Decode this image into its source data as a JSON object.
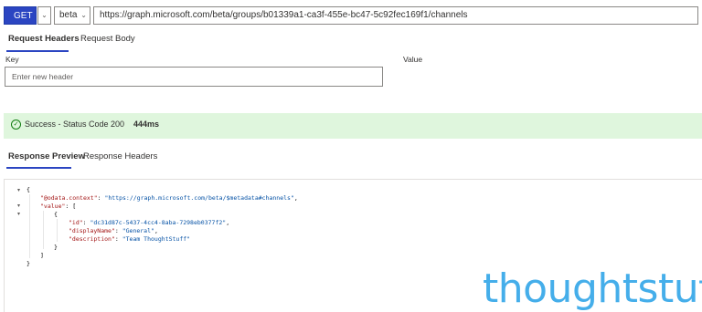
{
  "toolbar": {
    "method": "GET",
    "method_caret": "⌄",
    "version": "beta",
    "version_caret": "⌄",
    "url": "https://graph.microsoft.com/beta/groups/b01339a1-ca3f-455e-bc47-5c92fec169f1/channels"
  },
  "request_tabs": {
    "headers": "Request Headers",
    "body": "Request Body"
  },
  "headers_table": {
    "key_label": "Key",
    "value_label": "Value",
    "key_placeholder": "Enter new header"
  },
  "status": {
    "text": "Success - Status Code 200",
    "time": "444ms",
    "icon": "check-circle-icon"
  },
  "response_tabs": {
    "preview": "Response Preview",
    "headers": "Response Headers"
  },
  "response": {
    "open_brace": "{",
    "context_key": "\"@odata.context\"",
    "context_value": "\"https://graph.microsoft.com/beta/$metadata#channels\"",
    "value_key": "\"value\"",
    "open_bracket": "[",
    "item_open": "{",
    "id_key": "\"id\"",
    "id_value": "\"dc31d87c-5437-4cc4-8aba-7298eb0377f2\"",
    "name_key": "\"displayName\"",
    "name_value": "\"General\"",
    "desc_key": "\"description\"",
    "desc_value": "\"Team ThoughtStuff\"",
    "item_close": "}",
    "close_bracket": "]",
    "close_brace": "}"
  },
  "watermark": "thoughtstuff"
}
